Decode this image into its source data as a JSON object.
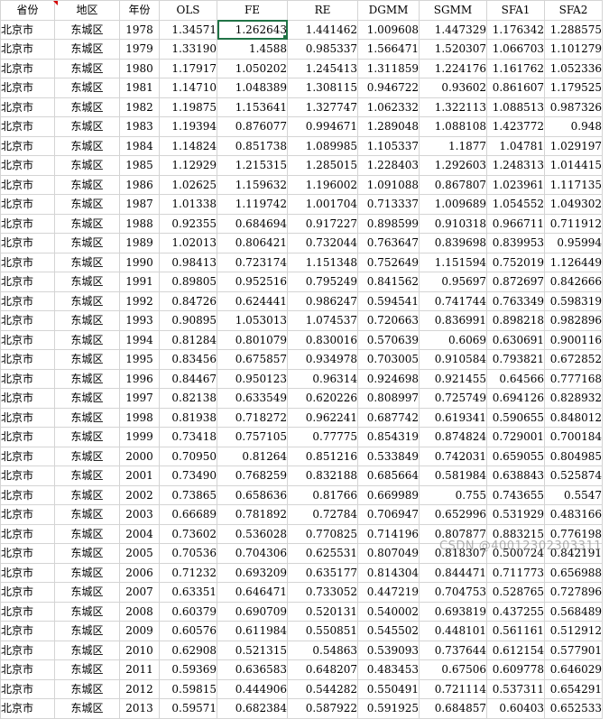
{
  "sheet": {
    "headers": [
      "省份",
      "地区",
      "年份",
      "OLS",
      "FE",
      "RE",
      "DGMM",
      "SGMM",
      "SFA1",
      "SFA2"
    ],
    "rows": [
      [
        "北京市",
        "东城区",
        "1978",
        "1.34571",
        "1.262643",
        "1.441462",
        "1.009608",
        "1.447329",
        "1.176342",
        "1.288575"
      ],
      [
        "北京市",
        "东城区",
        "1979",
        "1.33190",
        "1.4588",
        "0.985337",
        "1.566471",
        "1.520307",
        "1.066703",
        "1.101279"
      ],
      [
        "北京市",
        "东城区",
        "1980",
        "1.17917",
        "1.050202",
        "1.245413",
        "1.311859",
        "1.224176",
        "1.161762",
        "1.052336"
      ],
      [
        "北京市",
        "东城区",
        "1981",
        "1.14710",
        "1.048389",
        "1.308115",
        "0.946722",
        "0.93602",
        "0.861607",
        "1.179525"
      ],
      [
        "北京市",
        "东城区",
        "1982",
        "1.19875",
        "1.153641",
        "1.327747",
        "1.062332",
        "1.322113",
        "1.088513",
        "0.987326"
      ],
      [
        "北京市",
        "东城区",
        "1983",
        "1.19394",
        "0.876077",
        "0.994671",
        "1.289048",
        "1.088108",
        "1.423772",
        "0.948"
      ],
      [
        "北京市",
        "东城区",
        "1984",
        "1.14824",
        "0.851738",
        "1.089985",
        "1.105337",
        "1.1877",
        "1.04781",
        "1.029197"
      ],
      [
        "北京市",
        "东城区",
        "1985",
        "1.12929",
        "1.215315",
        "1.285015",
        "1.228403",
        "1.292603",
        "1.248313",
        "1.014415"
      ],
      [
        "北京市",
        "东城区",
        "1986",
        "1.02625",
        "1.159632",
        "1.196002",
        "1.091088",
        "0.867807",
        "1.023961",
        "1.117135"
      ],
      [
        "北京市",
        "东城区",
        "1987",
        "1.01338",
        "1.119742",
        "1.001704",
        "0.713337",
        "1.009689",
        "1.054552",
        "1.049302"
      ],
      [
        "北京市",
        "东城区",
        "1988",
        "0.92355",
        "0.684694",
        "0.917227",
        "0.898599",
        "0.910318",
        "0.966711",
        "0.711912"
      ],
      [
        "北京市",
        "东城区",
        "1989",
        "1.02013",
        "0.806421",
        "0.732044",
        "0.763647",
        "0.839698",
        "0.839953",
        "0.95994"
      ],
      [
        "北京市",
        "东城区",
        "1990",
        "0.98413",
        "0.723174",
        "1.151348",
        "0.752649",
        "1.151594",
        "0.752019",
        "1.126449"
      ],
      [
        "北京市",
        "东城区",
        "1991",
        "0.89805",
        "0.952516",
        "0.795249",
        "0.841562",
        "0.95697",
        "0.872697",
        "0.842666"
      ],
      [
        "北京市",
        "东城区",
        "1992",
        "0.84726",
        "0.624441",
        "0.986247",
        "0.594541",
        "0.741744",
        "0.763349",
        "0.598319"
      ],
      [
        "北京市",
        "东城区",
        "1993",
        "0.90895",
        "1.053013",
        "1.074537",
        "0.720663",
        "0.836991",
        "0.898218",
        "0.982896"
      ],
      [
        "北京市",
        "东城区",
        "1994",
        "0.81284",
        "0.801079",
        "0.830016",
        "0.570639",
        "0.6069",
        "0.630691",
        "0.900116"
      ],
      [
        "北京市",
        "东城区",
        "1995",
        "0.83456",
        "0.675857",
        "0.934978",
        "0.703005",
        "0.910584",
        "0.793821",
        "0.672852"
      ],
      [
        "北京市",
        "东城区",
        "1996",
        "0.84467",
        "0.950123",
        "0.96314",
        "0.924698",
        "0.921455",
        "0.64566",
        "0.777168"
      ],
      [
        "北京市",
        "东城区",
        "1997",
        "0.82138",
        "0.633549",
        "0.620226",
        "0.808997",
        "0.725749",
        "0.694126",
        "0.828932"
      ],
      [
        "北京市",
        "东城区",
        "1998",
        "0.81938",
        "0.718272",
        "0.962241",
        "0.687742",
        "0.619341",
        "0.590655",
        "0.848012"
      ],
      [
        "北京市",
        "东城区",
        "1999",
        "0.73418",
        "0.757105",
        "0.77775",
        "0.854319",
        "0.874824",
        "0.729001",
        "0.700184"
      ],
      [
        "北京市",
        "东城区",
        "2000",
        "0.70950",
        "0.81264",
        "0.851216",
        "0.533849",
        "0.742031",
        "0.659055",
        "0.804985"
      ],
      [
        "北京市",
        "东城区",
        "2001",
        "0.73490",
        "0.768259",
        "0.832188",
        "0.685664",
        "0.581984",
        "0.638843",
        "0.525874"
      ],
      [
        "北京市",
        "东城区",
        "2002",
        "0.73865",
        "0.658636",
        "0.81766",
        "0.669989",
        "0.755",
        "0.743655",
        "0.5547"
      ],
      [
        "北京市",
        "东城区",
        "2003",
        "0.66689",
        "0.781892",
        "0.72784",
        "0.706947",
        "0.652996",
        "0.531929",
        "0.483166"
      ],
      [
        "北京市",
        "东城区",
        "2004",
        "0.73602",
        "0.536028",
        "0.770825",
        "0.714196",
        "0.807877",
        "0.883215",
        "0.776198"
      ],
      [
        "北京市",
        "东城区",
        "2005",
        "0.70536",
        "0.704306",
        "0.625531",
        "0.807049",
        "0.818307",
        "0.500724",
        "0.842191"
      ],
      [
        "北京市",
        "东城区",
        "2006",
        "0.71232",
        "0.693209",
        "0.635177",
        "0.814304",
        "0.844471",
        "0.711773",
        "0.656988"
      ],
      [
        "北京市",
        "东城区",
        "2007",
        "0.63351",
        "0.646471",
        "0.733052",
        "0.447219",
        "0.704753",
        "0.528765",
        "0.727896"
      ],
      [
        "北京市",
        "东城区",
        "2008",
        "0.60379",
        "0.690709",
        "0.520131",
        "0.540002",
        "0.693819",
        "0.437255",
        "0.568489"
      ],
      [
        "北京市",
        "东城区",
        "2009",
        "0.60576",
        "0.611984",
        "0.550851",
        "0.545502",
        "0.448101",
        "0.561161",
        "0.512912"
      ],
      [
        "北京市",
        "东城区",
        "2010",
        "0.62908",
        "0.521315",
        "0.54863",
        "0.539093",
        "0.737644",
        "0.612154",
        "0.577901"
      ],
      [
        "北京市",
        "东城区",
        "2011",
        "0.59369",
        "0.636583",
        "0.648207",
        "0.483453",
        "0.67506",
        "0.609778",
        "0.646029"
      ],
      [
        "北京市",
        "东城区",
        "2012",
        "0.59815",
        "0.444906",
        "0.544282",
        "0.550491",
        "0.721114",
        "0.537311",
        "0.654291"
      ],
      [
        "北京市",
        "东城区",
        "2013",
        "0.59571",
        "0.682384",
        "0.587922",
        "0.591925",
        "0.684857",
        "0.60403",
        "0.652533"
      ]
    ],
    "selected_cell": {
      "row": 0,
      "col": 4
    }
  },
  "watermark": "CSDN @40012302303311"
}
